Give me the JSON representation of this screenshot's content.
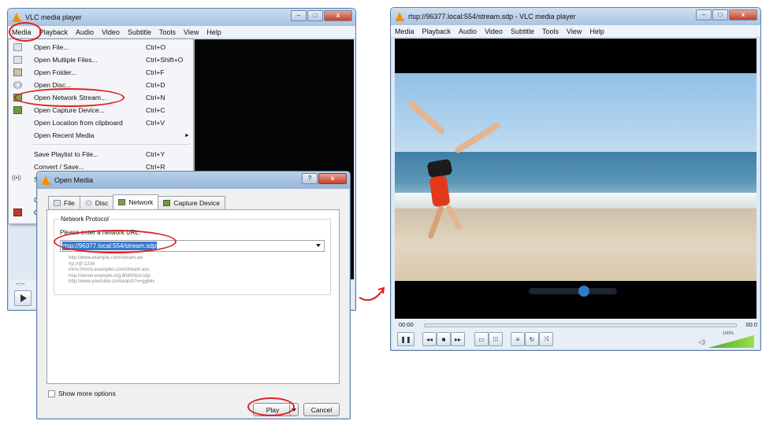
{
  "left_window": {
    "title": "VLC media player",
    "menus": [
      "Media",
      "Playback",
      "Audio",
      "Video",
      "Subtitle",
      "Tools",
      "View",
      "Help"
    ],
    "time": "--:--"
  },
  "media_menu": {
    "items": [
      {
        "label": "Open File...",
        "shortcut": "Ctrl+O",
        "icon": "file-icon"
      },
      {
        "label": "Open Multiple Files...",
        "shortcut": "Ctrl+Shift+O",
        "icon": "files-icon"
      },
      {
        "label": "Open Folder...",
        "shortcut": "Ctrl+F",
        "icon": "folder-icon"
      },
      {
        "label": "Open Disc...",
        "shortcut": "Ctrl+D",
        "icon": "disc-icon"
      },
      {
        "label": "Open Network Stream...",
        "shortcut": "Ctrl+N",
        "icon": "network-icon"
      },
      {
        "label": "Open Capture Device...",
        "shortcut": "Ctrl+C",
        "icon": "capture-icon"
      },
      {
        "label": "Open Location from clipboard",
        "shortcut": "Ctrl+V",
        "icon": ""
      },
      {
        "label": "Open Recent Media",
        "shortcut": "",
        "icon": "",
        "submenu": true
      },
      {
        "label": "Save Playlist to File...",
        "shortcut": "Ctrl+Y",
        "icon": ""
      },
      {
        "label": "Convert / Save...",
        "shortcut": "Ctrl+R",
        "icon": ""
      }
    ],
    "partial_items": [
      "S",
      "Q",
      "Q"
    ]
  },
  "dialog": {
    "title": "Open Media",
    "help": "?",
    "tabs": [
      "File",
      "Disc",
      "Network",
      "Capture Device"
    ],
    "group_title": "Network Protocol",
    "url_label": "Please enter a network URL:",
    "url_value": "rtsp://96377.local:554/stream.sdp",
    "examples": [
      "http://www.example.com/stream.avi",
      "rtp://@:1234",
      "mms://mms.examples.com/stream.asx",
      "rtsp://server.example.org:8080/test.sdp",
      "http://www.yourtube.com/watch?v=gg64x"
    ],
    "show_more": "Show more options",
    "play": "Play",
    "cancel": "Cancel"
  },
  "right_window": {
    "title": "rtsp://96377.local:554/stream.sdp - VLC media player",
    "menus": [
      "Media",
      "Playback",
      "Audio",
      "Video",
      "Subtitle",
      "Tools",
      "View",
      "Help"
    ],
    "time_elapsed": "00:00",
    "time_total": "00:0",
    "volume": "100%"
  },
  "colors": {
    "annotation": "#e02020",
    "selection": "#3a78c8",
    "vlc_orange": "#f39200"
  }
}
